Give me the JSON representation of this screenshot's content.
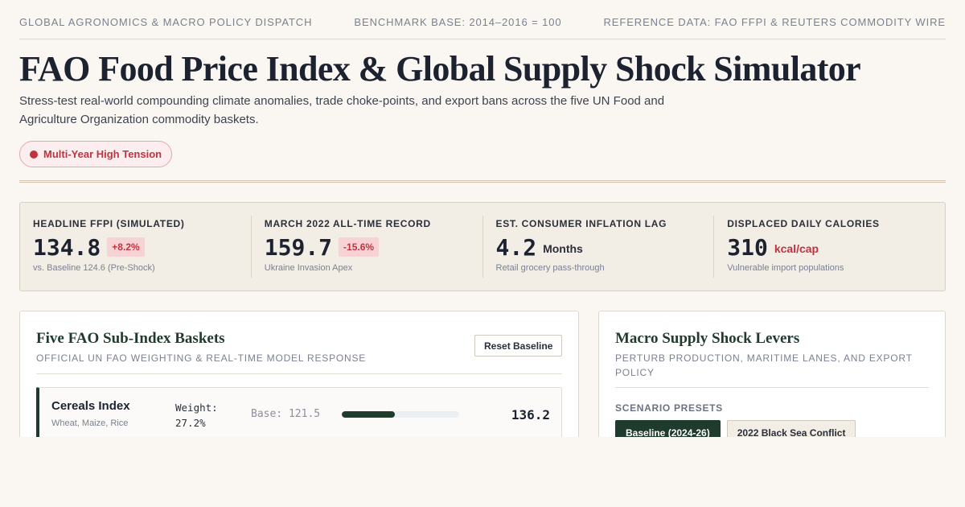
{
  "header": {
    "dispatch": "GLOBAL AGRONOMICS & MACRO POLICY DISPATCH",
    "benchmark": "BENCHMARK BASE: 2014–2016 = 100",
    "reference": "REFERENCE DATA: FAO FFPI & REUTERS COMMODITY WIRE"
  },
  "page": {
    "title": "FAO Food Price Index & Global Supply Shock Simulator",
    "subtitle": "Stress-test real-world compounding climate anomalies, trade choke-points, and export bans across the five UN Food and Agriculture Organization commodity baskets.",
    "status_badge": "Multi-Year High Tension",
    "status_color": "#c0343f"
  },
  "stats": [
    {
      "label": "HEADLINE FFPI (SIMULATED)",
      "value": "134.8",
      "badge": "+8.2%",
      "note": "vs. Baseline 124.6 (Pre-Shock)"
    },
    {
      "label": "MARCH 2022 ALL-TIME RECORD",
      "value": "159.7",
      "badge": "-15.6%",
      "note": "Ukraine Invasion Apex"
    },
    {
      "label": "EST. CONSUMER INFLATION LAG",
      "value": "4.2",
      "unit": "Months",
      "note": "Retail grocery pass-through"
    },
    {
      "label": "DISPLACED DAILY CALORIES",
      "value": "310",
      "unit": "kcal/cap",
      "note": "Vulnerable import populations"
    }
  ],
  "baskets_panel": {
    "title": "Five FAO Sub-Index Baskets",
    "subtitle": "OFFICIAL UN FAO WEIGHTING & REAL-TIME MODEL RESPONSE",
    "reset_label": "Reset Baseline",
    "rows": [
      {
        "name": "Cereals Index",
        "desc": "Wheat, Maize, Rice",
        "weight": "Weight: 27.2%",
        "base": "Base: 121.5",
        "value": "136.2",
        "bar_fraction": 0.45
      }
    ]
  },
  "levers_panel": {
    "title": "Macro Supply Shock Levers",
    "subtitle": "PERTURB PRODUCTION, MARITIME LANES, AND EXPORT POLICY",
    "presets_label": "SCENARIO PRESETS",
    "presets": [
      "Baseline (2024-26)",
      "2022 Black Sea Conflict"
    ],
    "active_preset": "Baseline (2024-26)"
  },
  "colors": {
    "accent_green": "#1f3b2d",
    "alert_red": "#c0343f",
    "background": "#faf7f2"
  }
}
